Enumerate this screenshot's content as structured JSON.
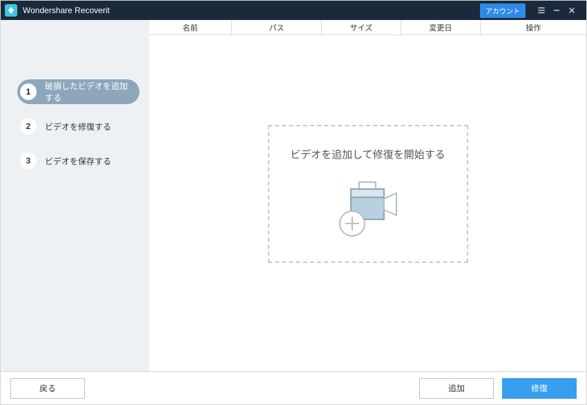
{
  "titlebar": {
    "app_name": "Wondershare Recoverit",
    "account_button": "アカウント"
  },
  "sidebar": {
    "steps": [
      {
        "num": "1",
        "label": "破損したビデオを追加する",
        "active": true
      },
      {
        "num": "2",
        "label": "ビデオを修復する",
        "active": false
      },
      {
        "num": "3",
        "label": "ビデオを保存する",
        "active": false
      }
    ]
  },
  "table": {
    "columns": {
      "name": "名前",
      "path": "パス",
      "size": "サイズ",
      "date": "変更日",
      "ops": "操作"
    }
  },
  "drop": {
    "message": "ビデオを追加して修復を開始する"
  },
  "footer": {
    "back": "戻る",
    "add": "追加",
    "repair": "修復"
  },
  "colors": {
    "accent": "#379ef0",
    "titlebar_bg": "#1a2a3a",
    "sidebar_bg": "#eef1f4",
    "step_active_bg": "#8ea6bb"
  }
}
